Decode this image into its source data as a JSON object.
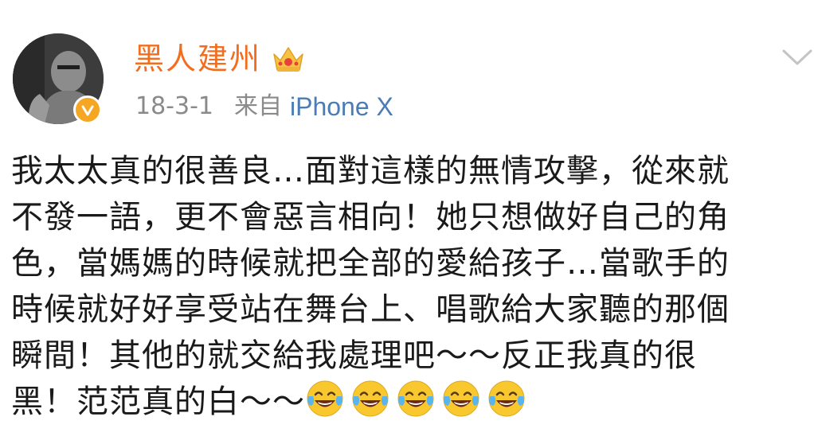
{
  "post": {
    "username": "黑人建州",
    "time": "18-3-1",
    "source_label": "来自",
    "source_device": "iPhone X",
    "content_lines": [
      "我太太真的很善良…面對這樣的無情攻擊，從來就",
      "不發一語，更不會惡言相向！她只想做好自己的角",
      "色，當媽媽的時候就把全部的愛給孩子…當歌手的",
      "時候就好好享受站在舞台上、唱歌給大家聽的那個",
      "瞬間！其他的就交給我處理吧～～反正我真的很",
      "黑！范范真的白～～"
    ],
    "emoji_count": 5,
    "emoji_name": "laughing-tears-emoji"
  },
  "colors": {
    "username": "#f36d1f",
    "time": "#8a8a8a",
    "device": "#4a7cb5",
    "text": "#1a1a1a",
    "verified_badge": "#f5a623"
  },
  "icons": {
    "avatar": "avatar-photo",
    "verified": "verified-v-badge",
    "membership": "crown-icon",
    "menu": "chevron-down-icon"
  }
}
